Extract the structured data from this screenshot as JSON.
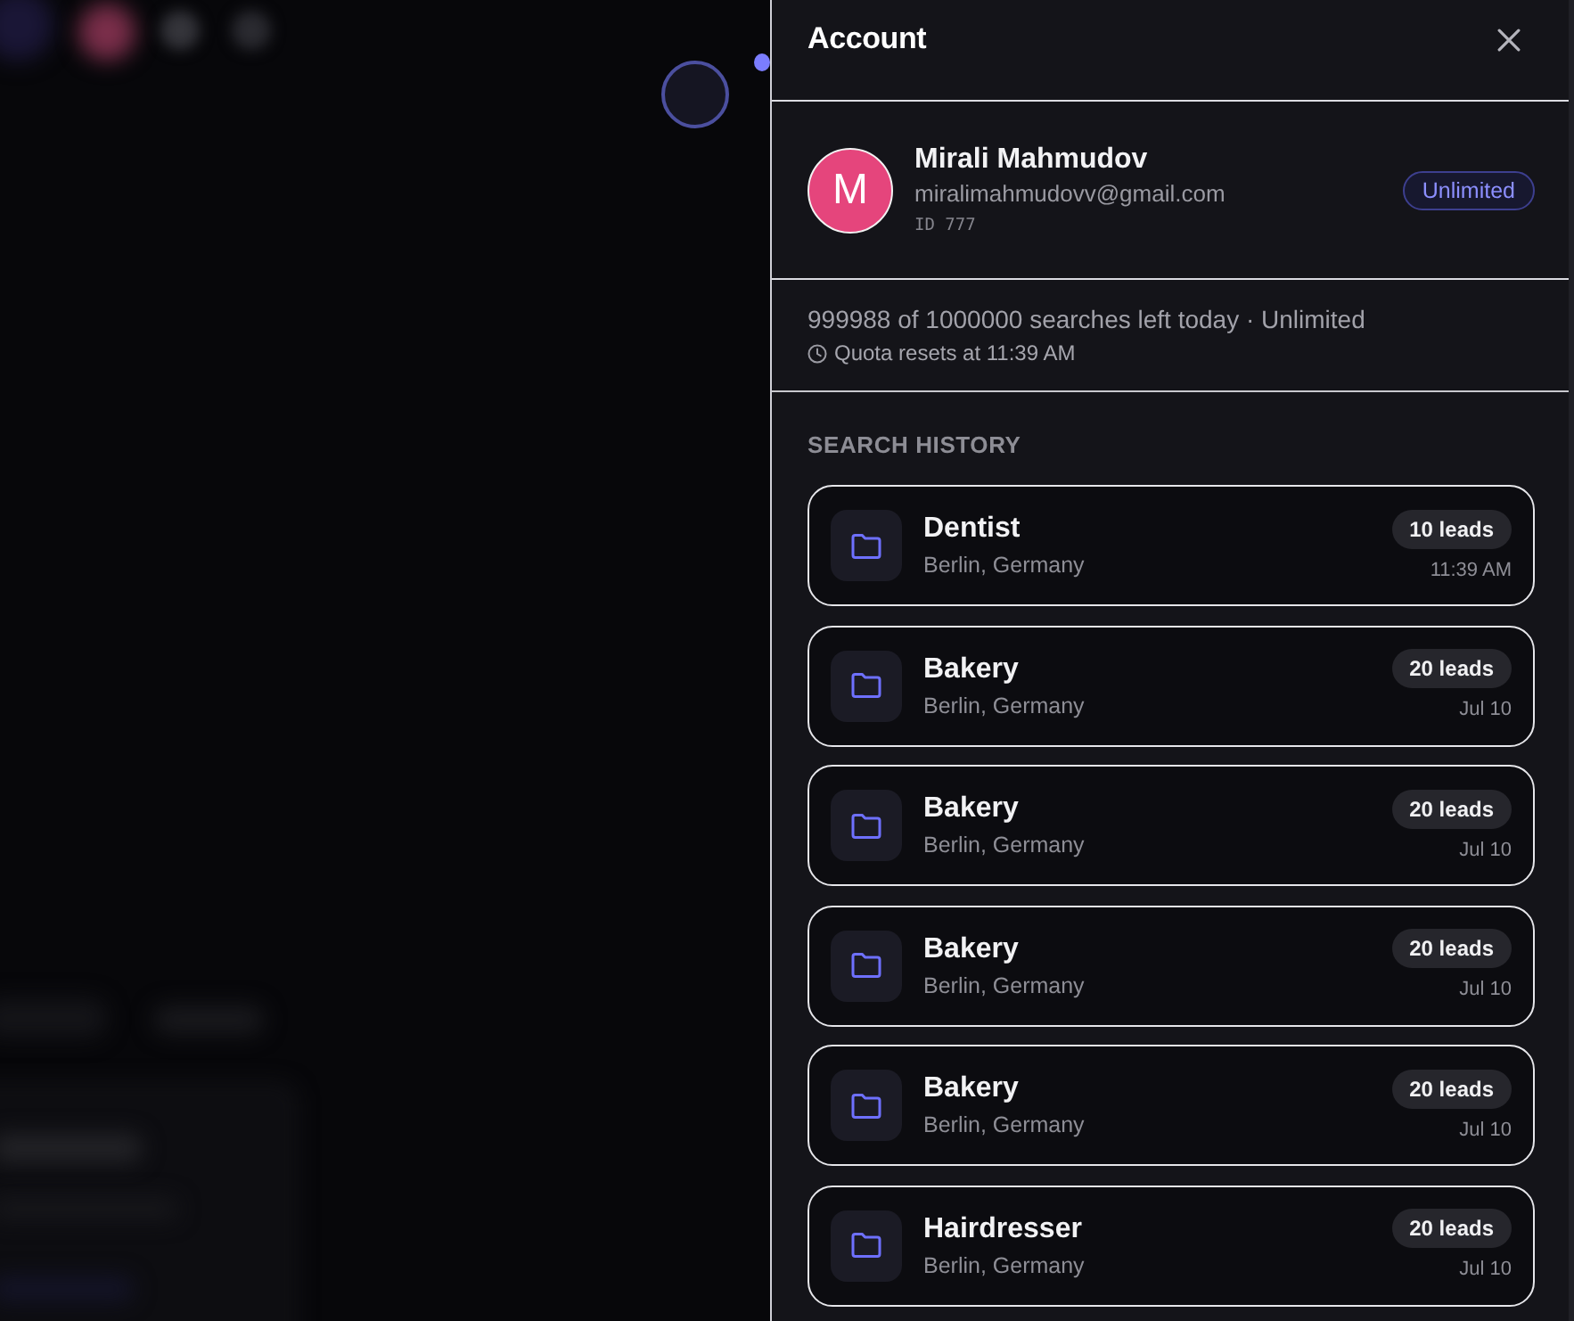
{
  "drawer": {
    "title": "Account"
  },
  "profile": {
    "initial": "M",
    "name": "Mirali Mahmudov",
    "email": "miralimahmudovv@gmail.com",
    "id": "ID 777",
    "plan_badge": "Unlimited"
  },
  "quota": {
    "summary": "999988 of 1000000 searches left today · Unlimited",
    "reset": "Quota resets at 11:39 AM"
  },
  "search_history": {
    "heading": "SEARCH HISTORY",
    "items": [
      {
        "query": "Dentist",
        "location": "Berlin, Germany",
        "leads": "10 leads",
        "time": "11:39 AM"
      },
      {
        "query": "Bakery",
        "location": "Berlin, Germany",
        "leads": "20 leads",
        "time": "Jul 10"
      },
      {
        "query": "Bakery",
        "location": "Berlin, Germany",
        "leads": "20 leads",
        "time": "Jul 10"
      },
      {
        "query": "Bakery",
        "location": "Berlin, Germany",
        "leads": "20 leads",
        "time": "Jul 10"
      },
      {
        "query": "Bakery",
        "location": "Berlin, Germany",
        "leads": "20 leads",
        "time": "Jul 10"
      },
      {
        "query": "Hairdresser",
        "location": "Berlin, Germany",
        "leads": "20 leads",
        "time": "Jul 10"
      }
    ]
  }
}
